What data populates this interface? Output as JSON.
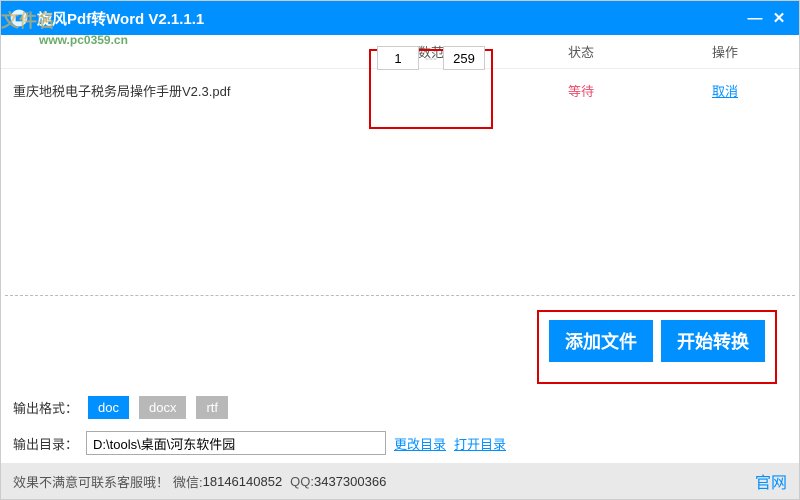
{
  "titlebar": {
    "title": "旋风Pdf转Word  V2.1.1.1"
  },
  "watermark": {
    "line1": "文件名",
    "line2": "www.pc0359.cn"
  },
  "headers": {
    "file": "",
    "range": "页数范围",
    "status": "状态",
    "op": "操作"
  },
  "rows": [
    {
      "filename": "重庆地税电子税务局操作手册V2.3.pdf",
      "from": "1",
      "to": "259",
      "status": "等待",
      "cancel": "取消"
    }
  ],
  "buttons": {
    "add": "添加文件",
    "start": "开始转换"
  },
  "format": {
    "label": "输出格式：",
    "options": [
      "doc",
      "docx",
      "rtf"
    ],
    "active": "doc"
  },
  "output": {
    "label": "输出目录：",
    "path": "D:\\tools\\桌面\\河东软件园",
    "change": "更改目录",
    "open": "打开目录"
  },
  "footer": {
    "text": "效果不满意可联系客服哦！",
    "wechat_label": "微信:",
    "wechat": "18146140852",
    "qq_label": "QQ:",
    "qq": "3437300366",
    "site": "官网"
  }
}
